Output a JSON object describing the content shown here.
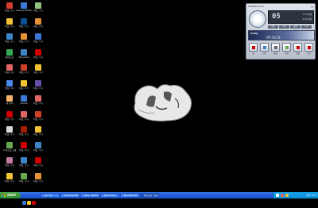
{
  "desktop": {
    "icons": [
      {
        "label": "바로 가기",
        "color": "#d33b2c"
      },
      {
        "label": "바로 가기",
        "color": "#f1c232"
      },
      {
        "label": "바로 가기",
        "color": "#3d85c6"
      },
      {
        "label": "네이트온",
        "color": "#34a853"
      },
      {
        "label": "바로 가기",
        "color": "#e06666"
      },
      {
        "label": "바로 가기",
        "color": "#4a86e8"
      },
      {
        "label": "내 문서",
        "color": "#f6b26b"
      },
      {
        "label": "바로 가기",
        "color": "#cc0000"
      },
      {
        "label": "바로 가기",
        "color": "#d9d9d9"
      },
      {
        "label": "시작프로그램",
        "color": "#6aa84f"
      },
      {
        "label": "바로 가기",
        "color": "#c27ba0"
      },
      {
        "label": "바로 가기",
        "color": "#f1c232"
      },
      {
        "label": "Internet Explorer",
        "color": "#3c78d8"
      },
      {
        "label": "바로 가기",
        "color": "#0b5394"
      },
      {
        "label": "바로 가기",
        "color": "#e69138"
      },
      {
        "label": "Windows",
        "color": "#3d85c6"
      },
      {
        "label": "바로 가기",
        "color": "#cc4125"
      },
      {
        "label": "바로 가기",
        "color": "#f1c232"
      },
      {
        "label": "Adobe",
        "color": "#3c78d8"
      },
      {
        "label": "바로 가기",
        "color": "#e06666"
      },
      {
        "label": "바로 가기",
        "color": "#a61c00"
      },
      {
        "label": "바로 가기",
        "color": "#cc0000"
      },
      {
        "label": "바로 가기",
        "color": "#3d85c6"
      },
      {
        "label": "바로 가기",
        "color": "#6aa84f"
      },
      {
        "label": "바로 가기",
        "color": "#93c47d"
      },
      {
        "label": "바로 가기",
        "color": "#e69138"
      },
      {
        "label": "바로 가기",
        "color": "#3c78d8"
      },
      {
        "label": "바로 가기",
        "color": "#cc0000"
      },
      {
        "label": "바로 가기",
        "color": "#f1c232"
      },
      {
        "label": "바로 가기",
        "color": "#674ea7"
      },
      {
        "label": "바로 가기",
        "color": "#e06666"
      },
      {
        "label": "바로 가기",
        "color": "#cc4125"
      },
      {
        "label": "바로 가기",
        "color": "#f1c232"
      },
      {
        "label": "바로 가기",
        "color": "#3d85c6"
      },
      {
        "label": "바로 가기",
        "color": "#cc0000"
      },
      {
        "label": "바로 가기",
        "color": "#e69138"
      }
    ]
  },
  "widget": {
    "title": "Software Info",
    "close": "×",
    "lcd_number": "05",
    "lcd_sub1": "4,050원",
    "lcd_sub2": "6,000원",
    "tabs": [
      "정보",
      "기능",
      "설정",
      "도움"
    ],
    "banner_text": "ALZip",
    "banner_sub": "압축 프로그램",
    "buttons": [
      {
        "label": "홈",
        "color": "#cc0000"
      },
      {
        "label": "검색",
        "color": "#3d85c6"
      },
      {
        "label": "설정",
        "color": "#666666"
      },
      {
        "label": "목록",
        "color": "#6aa84f"
      },
      {
        "label": "메일",
        "color": "#cc0000"
      },
      {
        "label": "종료",
        "color": "#cc0000"
      }
    ]
  },
  "taskbar": {
    "start_label": "start",
    "quick_launch": [
      "#3c78d8",
      "#f1c232",
      "#cc0000"
    ],
    "items": [
      {
        "label": "바로 가기",
        "active": false
      },
      {
        "label": "Windows Explorer",
        "active": false
      },
      {
        "label": "Daily - Windows",
        "active": false
      },
      {
        "label": "New Folder",
        "active": false
      },
      {
        "label": "Microsoft Word",
        "active": false
      },
      {
        "label": "제목 없음 - 메모장",
        "active": true
      }
    ],
    "tray_colors": [
      "#ffffff",
      "#e06666",
      "#f1c232"
    ],
    "clock": "오후 3:27"
  }
}
